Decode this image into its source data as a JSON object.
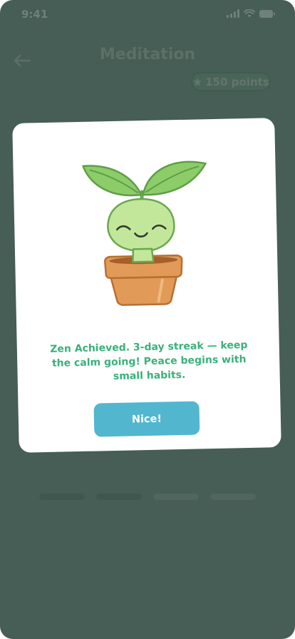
{
  "status_bar": {
    "time": "9:41",
    "icons": [
      "signal-icon",
      "wifi-icon",
      "battery-icon"
    ]
  },
  "header": {
    "back_icon": "arrow-left-icon",
    "title": "Meditation"
  },
  "points": {
    "icon": "star-icon",
    "label": "150 points"
  },
  "progress": {
    "total_steps": 4,
    "completed_steps": 2
  },
  "modal": {
    "illustration": "smiling-sprout-in-pot",
    "message": "Zen Achieved. 3-day streak — keep the calm going! Peace begins with small habits.",
    "button_label": "Nice!"
  },
  "colors": {
    "background_overlay": "#465e55",
    "accent_green": "#3ab07b",
    "button_blue": "#52b6cf",
    "card": "#ffffff"
  }
}
